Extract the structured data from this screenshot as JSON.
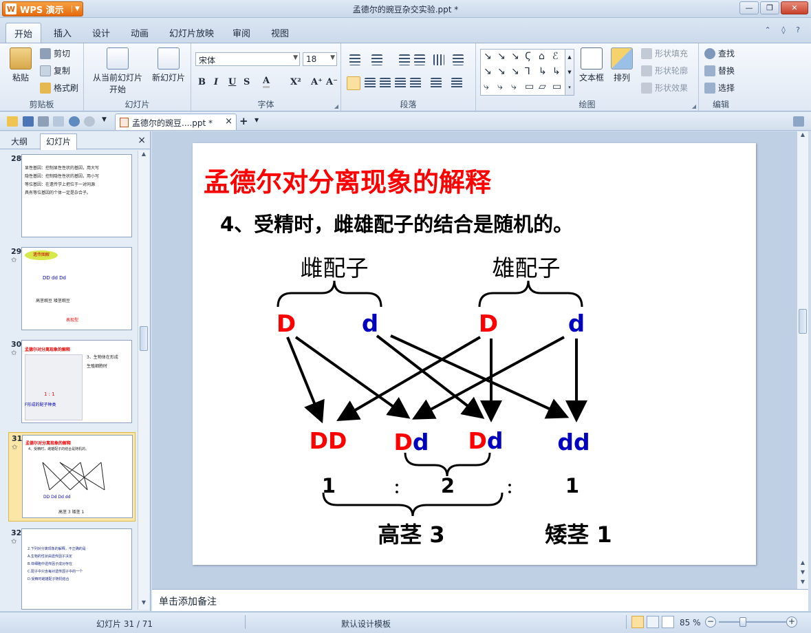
{
  "app": {
    "button_label": "WPS 演示",
    "window_title": "孟德尔的豌豆杂交实验.ppt *"
  },
  "window_controls": {
    "minimize": "—",
    "restore": "❐",
    "close": "✕"
  },
  "ribbon_tabs": [
    "开始",
    "插入",
    "设计",
    "动画",
    "幻灯片放映",
    "审阅",
    "视图"
  ],
  "ribbon": {
    "clipboard": {
      "group": "剪贴板",
      "paste": "粘贴",
      "cut": "剪切",
      "copy": "复制",
      "format_painter": "格式刷"
    },
    "slides": {
      "group": "幻灯片",
      "from_current": "从当前幻灯片",
      "start": "开始",
      "new_slide": "新幻灯片"
    },
    "font": {
      "group": "字体",
      "font_name": "宋体",
      "font_size": "18",
      "bold": "B",
      "italic": "I",
      "underline": "U",
      "shadow": "S",
      "color": "A",
      "superscript": "X²",
      "grow": "A⁺",
      "shrink": "A⁻"
    },
    "paragraph": {
      "group": "段落"
    },
    "drawing": {
      "group": "绘图",
      "textbox": "文本框",
      "arrange": "排列",
      "fill": "形状填充",
      "outline": "形状轮廓",
      "effects": "形状效果"
    },
    "editing": {
      "group": "编辑",
      "find": "查找",
      "replace": "替换",
      "select": "选择"
    }
  },
  "doc_tab": {
    "title": "孟德尔的豌豆....ppt *",
    "close": "×",
    "new": "+"
  },
  "left_panel": {
    "tabs": [
      "大纲",
      "幻灯片"
    ],
    "close": "×",
    "thumbnails": [
      {
        "num": "28",
        "star": "",
        "lines": [
          "显性基因：控制显性性状的基因，用大写",
          "隐性基因：控制隐性性状的基因，用小写",
          "等位基因：在遗传学上把位于一对同源",
          "具有等位基因的个体一定是杂合子。"
        ]
      },
      {
        "num": "29",
        "star": "✩",
        "lines": [
          "遗传图解",
          "DD  dd  Dd",
          "高茎豌豆  矮茎豌豆",
          "表现型"
        ]
      },
      {
        "num": "30",
        "star": "✩",
        "lines": [
          "孟德尔对分离现象的解释",
          "3、生物体在形成",
          "生殖细胞时",
          "F形成的配子种类",
          "1 : 1"
        ]
      },
      {
        "num": "31",
        "star": "✩",
        "lines": [
          "孟德尔对分离现象的解释",
          "4、受精时，雌雄配子的结合是随机的。",
          "DD  Dd  Dd  dd",
          "高茎 3   矮茎 1"
        ]
      },
      {
        "num": "32",
        "star": "✩",
        "lines": [
          "2.下列对分离现象的解释，不正确的是",
          "A.生物的性状由遗传因子决定",
          "B.体细胞中遗传因子成对存在",
          "C.配子中只含每对遗传因子中的一个",
          "D.受精时雌雄配子随机结合"
        ]
      }
    ]
  },
  "slide": {
    "title": "孟德尔对分离现象的解释",
    "point": "4、受精时，雌雄配子的结合是随机的。",
    "female_label": "雌配子",
    "male_label": "雄配子",
    "gametes": [
      "D",
      "d",
      "D",
      "d"
    ],
    "offspring": [
      {
        "a": "D",
        "b": "D"
      },
      {
        "a": "D",
        "b": "d"
      },
      {
        "a": "D",
        "b": "d"
      },
      {
        "a": "d",
        "b": "d"
      }
    ],
    "ratio": [
      "1",
      "：",
      "2",
      "：",
      "1"
    ],
    "tall": "高茎  3",
    "short": "矮茎  1",
    "colors": {
      "title": "#ff0000",
      "dominant": "#ff0000",
      "recessive": "#0000c0",
      "text": "#000000"
    }
  },
  "notes": {
    "placeholder": "单击添加备注"
  },
  "status": {
    "slide_counter": "幻灯片 31 / 71",
    "template": "默认设计模板",
    "zoom": "85 %"
  }
}
